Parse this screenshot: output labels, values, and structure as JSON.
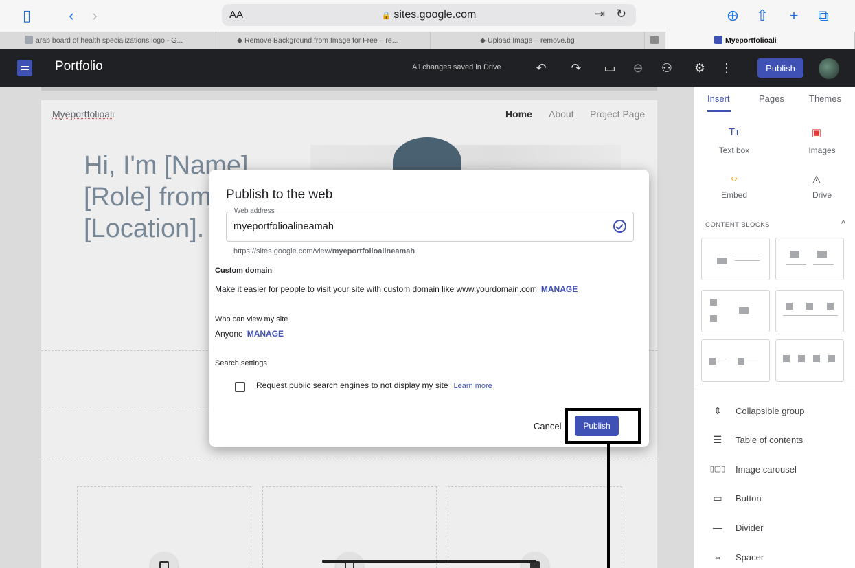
{
  "browser": {
    "aa_label": "AA",
    "url": "sites.google.com",
    "tabs": [
      {
        "title": "arab board of health specializations logo - G..."
      },
      {
        "title": "Remove Background from Image for Free – re..."
      },
      {
        "title": "Upload Image – remove.bg"
      },
      {
        "title": ""
      },
      {
        "title": "Myeportfolioali"
      }
    ]
  },
  "sites_header": {
    "title": "Portfolio",
    "saved_status": "All changes saved in Drive",
    "publish_label": "Publish"
  },
  "page": {
    "site_name": "Myeportfolioali",
    "nav": [
      "Home",
      "About",
      "Project Page"
    ],
    "hero_lines": [
      "Hi, I'm [Name], a",
      "[Role] from",
      "[Location]."
    ]
  },
  "panel": {
    "tabs": [
      "Insert",
      "Pages",
      "Themes"
    ],
    "insert_items": [
      {
        "label": "Text box",
        "icon": "text-box-icon",
        "glyph": "Tт"
      },
      {
        "label": "Images",
        "icon": "images-icon",
        "glyph": "▣"
      },
      {
        "label": "Embed",
        "icon": "embed-icon",
        "glyph": "‹›"
      },
      {
        "label": "Drive",
        "icon": "drive-icon",
        "glyph": "◬"
      }
    ],
    "content_blocks_label": "CONTENT BLOCKS",
    "components": [
      {
        "label": "Collapsible group",
        "glyph": "⇕"
      },
      {
        "label": "Table of contents",
        "glyph": "☰"
      },
      {
        "label": "Image carousel",
        "glyph": "▯▢▯"
      },
      {
        "label": "Button",
        "glyph": "▭"
      },
      {
        "label": "Divider",
        "glyph": "—"
      },
      {
        "label": "Spacer",
        "glyph": "⇔"
      }
    ]
  },
  "modal": {
    "title": "Publish to the web",
    "web_address_label": "Web address",
    "web_address_value": "myeportfolioalineamah",
    "url_prefix": "https://sites.google.com/view/",
    "url_slug": "myeportfolioalineamah",
    "custom_domain_title": "Custom domain",
    "custom_domain_text": "Make it easier for people to visit your site with custom domain like www.yourdomain.com",
    "manage_label": "MANAGE",
    "who_can_view_title": "Who can view my site",
    "who_can_view_value": "Anyone",
    "search_settings_title": "Search settings",
    "search_checkbox_label": "Request public search engines to not display my site",
    "learn_more": "Learn more",
    "cancel_label": "Cancel",
    "publish_label": "Publish"
  },
  "colors": {
    "accent": "#3f51b5",
    "header_bg": "#202124"
  }
}
